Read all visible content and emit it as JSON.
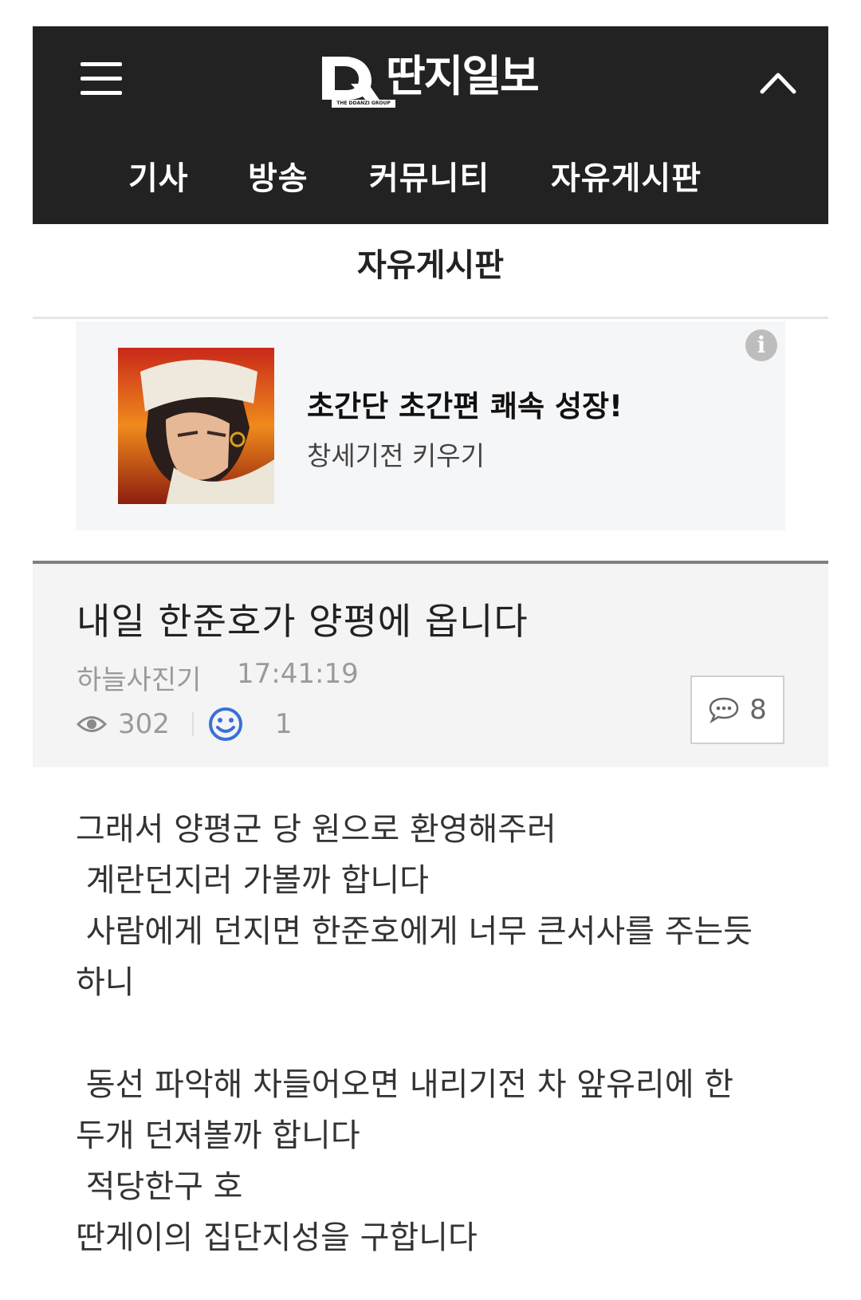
{
  "header": {
    "logo_text": "딴지일보",
    "logo_subtext": "THE DDANZI GROUP",
    "nav": [
      "기사",
      "방송",
      "커뮤니티",
      "자유게시판"
    ]
  },
  "board": {
    "title": "자유게시판"
  },
  "ad": {
    "title": "초간단 초간편 쾌속 성장!",
    "subtitle": "창세기전 키우기",
    "info_icon": "i"
  },
  "post": {
    "title": "내일 한준호가 양평에 옵니다",
    "author": "하늘사진기",
    "time": "17:41:19",
    "views": "302",
    "likes": "1",
    "comments": "8",
    "body": "그래서 양평군 당 원으로 환영해주러\n 계란던지러 가볼까 합니다\n 사람에게 던지면 한준호에게 너무 큰서사를 주는듯\n하니\n\n 동선 파악해 차들어오면 내리기전 차 앞유리에 한\n두개 던져볼까 합니다\n 적당한구 호\n딴게이의 집단지성을 구합니다"
  },
  "colors": {
    "header_bg": "#222222",
    "ad_bg": "#f5f6f8",
    "meta_gray": "#9a9a9a",
    "accent_blue": "#3a6fd8"
  }
}
